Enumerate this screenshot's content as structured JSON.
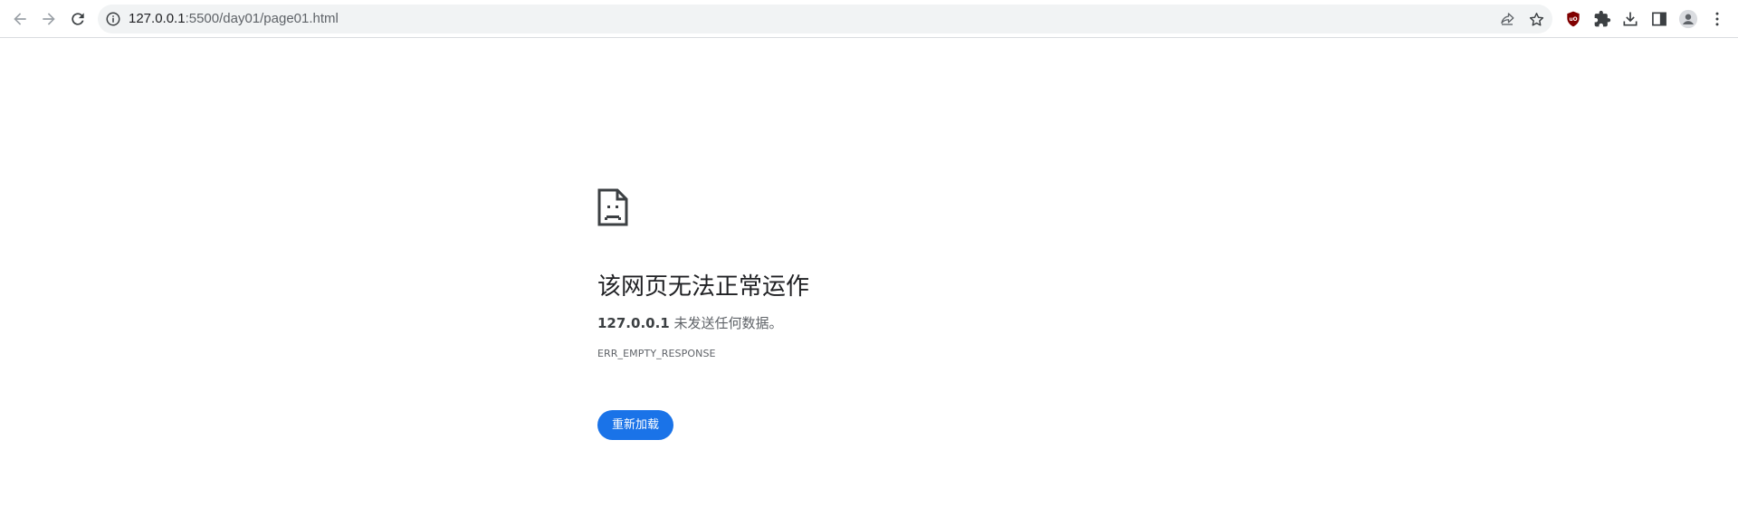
{
  "browser": {
    "url_host": "127.0.0.1",
    "url_path": ":5500/day01/page01.html",
    "icons": {
      "back": "arrow-left-icon",
      "forward": "arrow-right-icon",
      "reload": "reload-icon",
      "site_info": "info-icon",
      "share": "share-icon",
      "bookmark": "star-icon",
      "ublock": "ublock-origin-icon",
      "extensions": "puzzle-icon",
      "downloads": "download-icon",
      "side_panel": "side-panel-icon",
      "profile": "profile-icon",
      "menu": "kebab-menu-icon"
    },
    "ublock_badge": "uO"
  },
  "error_page": {
    "icon": "sad-document-icon",
    "title": "该网页无法正常运作",
    "host": "127.0.0.1",
    "description_suffix": " 未发送任何数据。",
    "error_code": "ERR_EMPTY_RESPONSE",
    "reload_label": "重新加载"
  },
  "colors": {
    "accent": "#1a73e8",
    "ublock_red": "#800000",
    "icon_gray": "#5f6368",
    "disabled_gray": "#9aa0a6",
    "omnibox_bg": "#f1f3f4"
  }
}
